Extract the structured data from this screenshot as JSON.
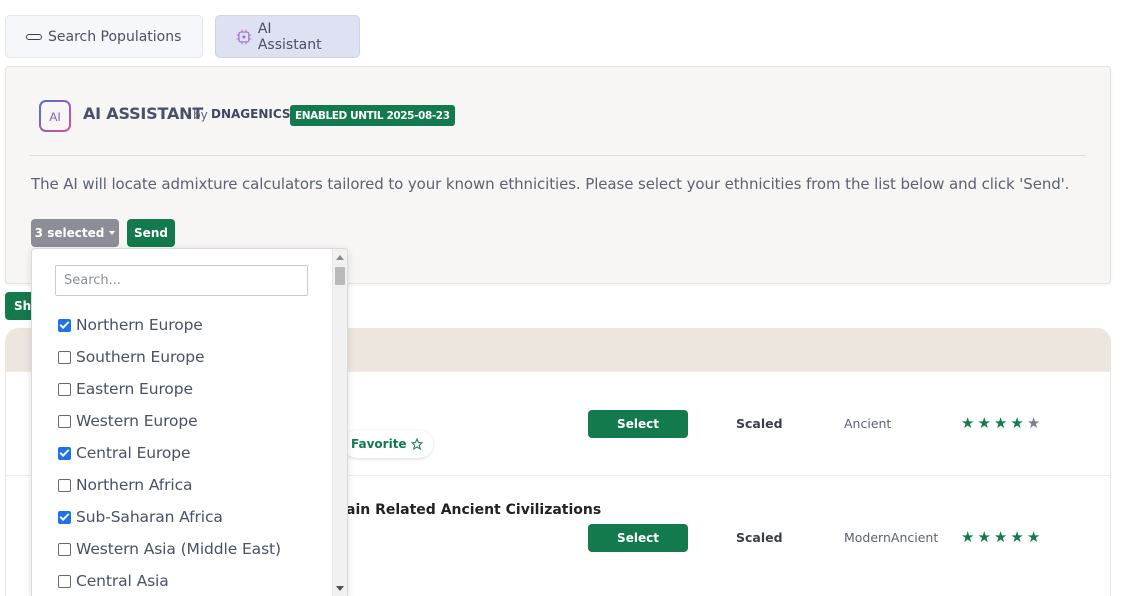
{
  "tabs": [
    {
      "label": "Search Populations",
      "icon": "pill-icon"
    },
    {
      "label": "AI Assistant",
      "icon": "ai-chip-icon"
    }
  ],
  "assistant": {
    "logo_text": "AI",
    "title": "AI ASSISTANT",
    "by": "by",
    "brand": "DNAGENICS",
    "enabled_badge": "ENABLED UNTIL 2025-08-23",
    "description": "The AI will locate admixture calculators tailored to your known ethnicities. Please select your ethnicities from the list below and click 'Send'.",
    "selected_label": "3 selected",
    "send_label": "Send"
  },
  "dropdown": {
    "search_placeholder": "Search...",
    "items": [
      {
        "label": "Northern Europe",
        "checked": true
      },
      {
        "label": "Southern Europe",
        "checked": false
      },
      {
        "label": "Eastern Europe",
        "checked": false
      },
      {
        "label": "Western Europe",
        "checked": false
      },
      {
        "label": "Central Europe",
        "checked": true
      },
      {
        "label": "Northern Africa",
        "checked": false
      },
      {
        "label": "Sub-Saharan Africa",
        "checked": true
      },
      {
        "label": "Western Asia (Middle East)",
        "checked": false
      },
      {
        "label": "Central Asia",
        "checked": false
      }
    ]
  },
  "background": {
    "tag_label": "Sh",
    "rows": [
      {
        "favorite_label": "Favorite",
        "title": "",
        "select_label": "Select",
        "scale": "Scaled",
        "era": "Ancient",
        "stars": 4
      },
      {
        "favorite_label": "",
        "title": "ain Related Ancient Civilizations",
        "select_label": "Select",
        "scale": "Scaled",
        "era": "ModernAncient",
        "stars": 5
      }
    ]
  },
  "colors": {
    "accent_green": "#137a4d",
    "tab_active_bg": "#dde1f1",
    "checkbox_blue": "#1a73e8"
  }
}
